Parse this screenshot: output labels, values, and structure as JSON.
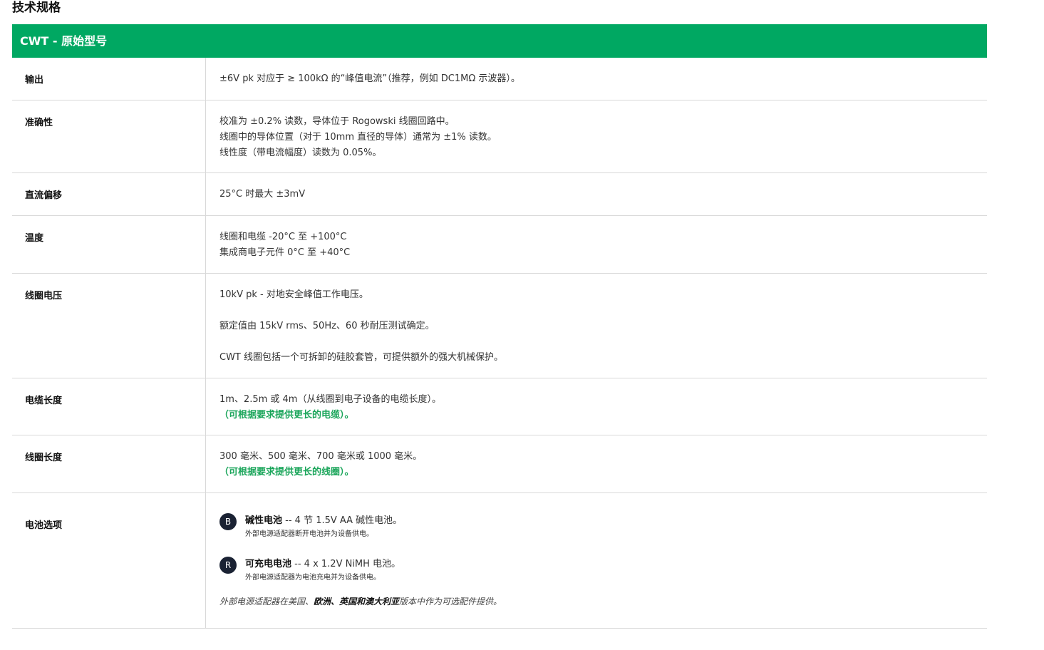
{
  "page_title": "技术规格",
  "table_title": "CWT - 原始型号",
  "rows": {
    "output": {
      "label": "输出",
      "lines": [
        "±6V pk 对应于 ≥ 100kΩ 的“峰值电流”（推荐，例如 DC1MΩ 示波器）。"
      ]
    },
    "accuracy": {
      "label": "准确性",
      "lines": [
        "校准为 ±0.2% 读数，导体位于 Rogowski 线圈回路中。",
        "线圈中的导体位置（对于 10mm 直径的导体）通常为 ±1% 读数。",
        "线性度（带电流幅度）读数为 0.05%。"
      ]
    },
    "dc_offset": {
      "label": "直流偏移",
      "lines": [
        "25°C 时最大 ±3mV"
      ]
    },
    "temperature": {
      "label": "温度",
      "lines": [
        "线圈和电缆 -20°C 至 +100°C",
        "集成商电子元件 0°C 至 +40°C"
      ]
    },
    "coil_voltage": {
      "label": "线圈电压",
      "lines": [
        "10kV pk - 对地安全峰值工作电压。",
        "额定值由 15kV rms、50Hz、60 秒耐压测试确定。",
        "CWT 线圈包括一个可拆卸的硅胶套管，可提供额外的强大机械保护。"
      ]
    },
    "cable_length": {
      "label": "电缆长度",
      "lines": [
        "1m、2.5m 或 4m（从线圈到电子设备的电缆长度）。"
      ],
      "note": "（可根据要求提供更长的电缆）。"
    },
    "coil_length": {
      "label": "线圈长度",
      "lines": [
        "300 毫米、500 毫米、700 毫米或 1000 毫米。"
      ],
      "note": "（可根据要求提供更长的线圈）。"
    },
    "battery": {
      "label": "电池选项",
      "options": [
        {
          "badge": "B",
          "title": "碱性电池",
          "detail": " -- 4 节 1.5V AA 碱性电池。",
          "sub": "外部电源适配器断开电池并为设备供电。"
        },
        {
          "badge": "R",
          "title": "可充电电池",
          "detail": " -- 4 x 1.2V NiMH 电池。",
          "sub": "外部电源适配器为电池充电并为设备供电。"
        }
      ],
      "footnote": {
        "pre": "外部电源适配器在美国、",
        "bold": "欧洲、英国和澳大利亚",
        "post": "版本中作为可选配件提供。"
      }
    }
  },
  "colors": {
    "header_bg": "#00a862",
    "note_green": "#1aa55a",
    "badge_bg": "#1a2233"
  }
}
